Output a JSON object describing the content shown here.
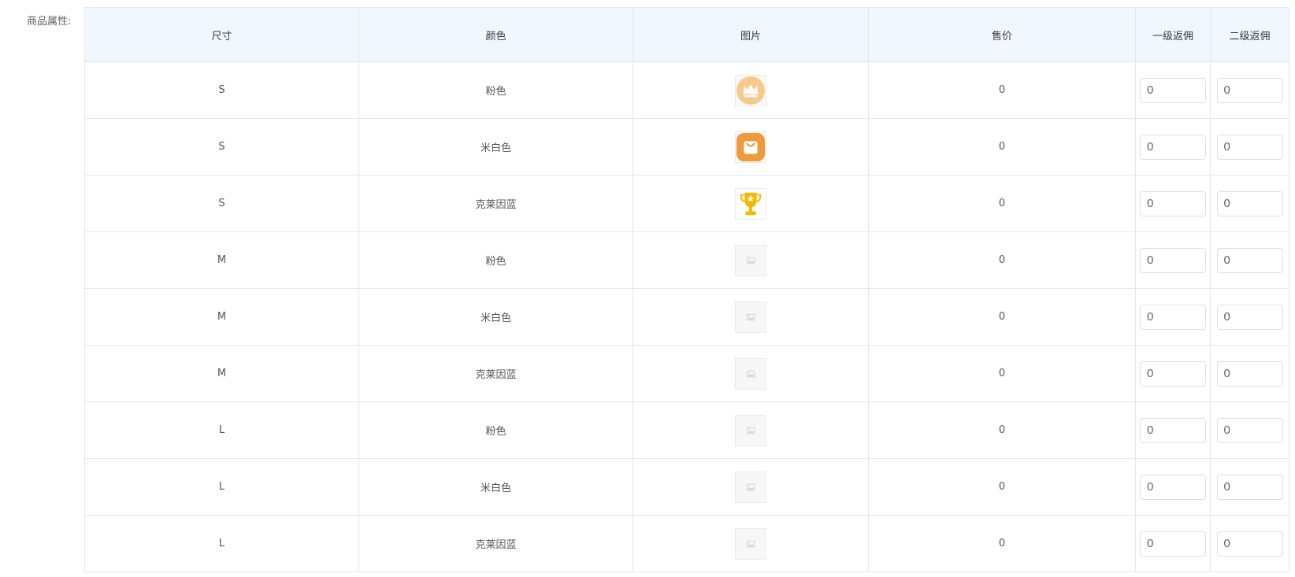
{
  "form": {
    "label": "商品属性:"
  },
  "table": {
    "headers": {
      "size": "尺寸",
      "color": "颜色",
      "image": "图片",
      "price": "售价",
      "rebate1": "一级返佣",
      "rebate2": "二级返佣"
    },
    "rows": [
      {
        "size": "S",
        "color": "粉色",
        "image_icon": "crown-icon",
        "price": "0",
        "rebate1": "0",
        "rebate2": "0"
      },
      {
        "size": "S",
        "color": "米白色",
        "image_icon": "shopping-bag-icon",
        "price": "0",
        "rebate1": "0",
        "rebate2": "0"
      },
      {
        "size": "S",
        "color": "克莱因蓝",
        "image_icon": "trophy-icon",
        "price": "0",
        "rebate1": "0",
        "rebate2": "0"
      },
      {
        "size": "M",
        "color": "粉色",
        "image_icon": "image-placeholder-icon",
        "price": "0",
        "rebate1": "0",
        "rebate2": "0"
      },
      {
        "size": "M",
        "color": "米白色",
        "image_icon": "image-placeholder-icon",
        "price": "0",
        "rebate1": "0",
        "rebate2": "0"
      },
      {
        "size": "M",
        "color": "克莱因蓝",
        "image_icon": "image-placeholder-icon",
        "price": "0",
        "rebate1": "0",
        "rebate2": "0"
      },
      {
        "size": "L",
        "color": "粉色",
        "image_icon": "image-placeholder-icon",
        "price": "0",
        "rebate1": "0",
        "rebate2": "0"
      },
      {
        "size": "L",
        "color": "米白色",
        "image_icon": "image-placeholder-icon",
        "price": "0",
        "rebate1": "0",
        "rebate2": "0"
      },
      {
        "size": "L",
        "color": "克莱因蓝",
        "image_icon": "image-placeholder-icon",
        "price": "0",
        "rebate1": "0",
        "rebate2": "0"
      }
    ]
  },
  "colors": {
    "header_bg": "#f0f7ff",
    "border": "#e4e7ed",
    "crown": "#f7c98a",
    "bag": "#ef9a3c",
    "trophy": "#f5b800"
  }
}
